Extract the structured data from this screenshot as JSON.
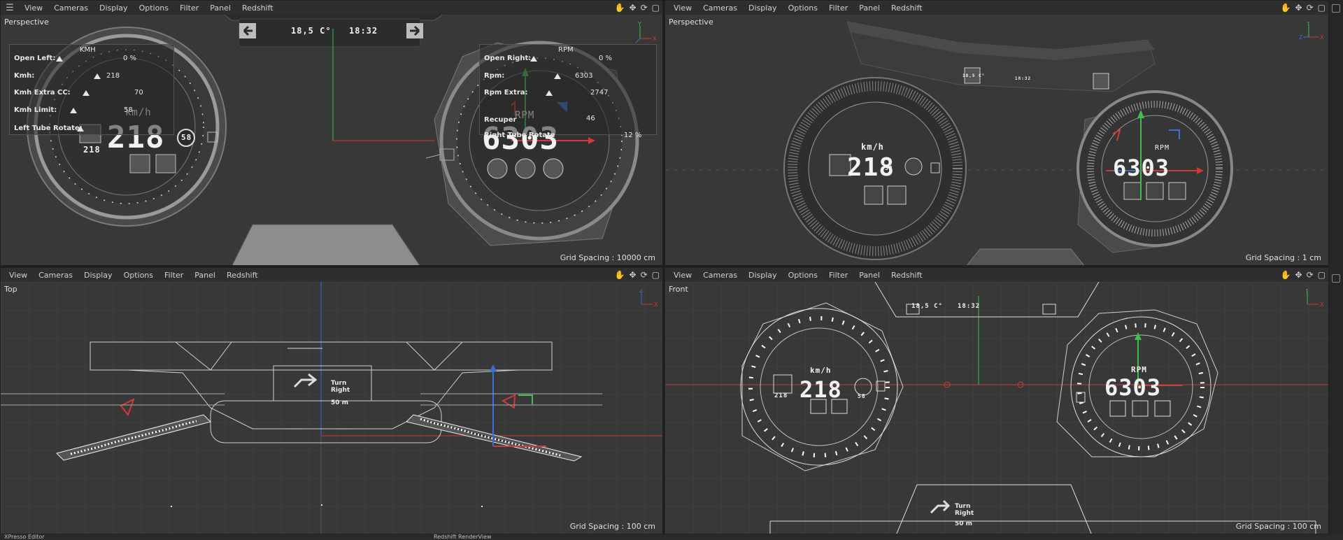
{
  "menus": [
    "View",
    "Cameras",
    "Display",
    "Options",
    "Filter",
    "Panel",
    "Redshift"
  ],
  "nav_icons": [
    "hand-icon",
    "move-icon",
    "rotate-icon",
    "maximize-icon"
  ],
  "viewports": {
    "tl": {
      "label": "Perspective",
      "grid": "Grid Spacing : 10000 cm"
    },
    "tr": {
      "label": "Perspective",
      "grid": "Grid Spacing : 1 cm"
    },
    "bl": {
      "label": "Top",
      "grid": "Grid Spacing : 100 cm"
    },
    "br": {
      "label": "Front",
      "grid": "Grid Spacing : 100 cm"
    }
  },
  "axes": {
    "x": "X",
    "y": "Y",
    "z": "Z"
  },
  "left_panel": {
    "header": "KMH",
    "rows": [
      {
        "label": "Open Left:",
        "value": "0 %"
      },
      {
        "label": "Kmh:",
        "value": "218"
      },
      {
        "label": "Kmh Extra CC:",
        "value": "70"
      },
      {
        "label": "Kmh Limit:",
        "value": "58"
      },
      {
        "label": "Left Tube Rotate:",
        "value": ""
      }
    ]
  },
  "right_panel": {
    "header": "RPM",
    "rows": [
      {
        "label": "Open Right:",
        "value": "0 %"
      },
      {
        "label": "Rpm:",
        "value": "6303"
      },
      {
        "label": "Rpm Extra:",
        "value": "2747"
      },
      {
        "label": "Recuper",
        "value": "46"
      },
      {
        "label": "Right Tube Rotate",
        "value": "12 %"
      }
    ]
  },
  "hud": {
    "temp": "18,5 C°",
    "time": "18:32",
    "speed": "218",
    "speed_small": "218",
    "speed_unit": "km/h",
    "rpm": "6303",
    "rpm_label": "RPM",
    "limit": "58",
    "turn_text": "Turn Right",
    "distance": "50 m"
  },
  "bottom_bar": {
    "left": "XPresso Editor",
    "right": "Redshift RenderView"
  },
  "colors": {
    "x_axis": "#d03a3a",
    "y_axis": "#3fbf4f",
    "z_axis": "#3b6fd6",
    "viewport_bg": "#383838",
    "menubar_bg": "#2e2e2e"
  }
}
